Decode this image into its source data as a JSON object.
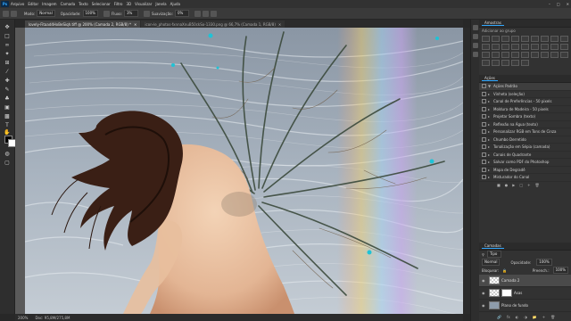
{
  "app": {
    "logo": "Ps",
    "menus": [
      "Arquivo",
      "Editar",
      "Imagem",
      "Camada",
      "Texto",
      "Selecionar",
      "Filtro",
      "3D",
      "Visualizar",
      "Janela",
      "Ajuda"
    ]
  },
  "options_bar": {
    "mode_label": "Modo:",
    "mode_value": "Normal",
    "opacity_label": "Opacidade:",
    "opacity_value": "100%",
    "flow_label": "Fluxo:",
    "flow_value": "3%",
    "smoothing_label": "Suavização:",
    "smoothing_value": "0%"
  },
  "doc_tabs": [
    {
      "label": "lovely-Fitaad4HxBeSiqh.tiff @ 200% (Camada 2, RGB/8) *",
      "active": true
    },
    {
      "label": "icon-le_photos-fxnnaXnuB50ckSo-1330.png @ 66,7% (Camada 1, RGB/8)",
      "active": false
    }
  ],
  "status": {
    "zoom": "200%",
    "doc": "Doc: 95,8M/275,8M"
  },
  "panels": {
    "swatches_title": "Amostras",
    "swatches_sub": "Adicionar ao grupo",
    "actions_title": "Ações",
    "actions": [
      "Ações Padrão",
      "Vinheta (seleção)",
      "Canal de Preferências - 50 pixels",
      "Moldura de Madeira - 50 pixels",
      "Projetar Sombra (texto)",
      "Reflexão na Água (texto)",
      "Personalizar RGB em Tons de Cinza",
      "Chumbo Derretido",
      "Tonalização em Sépia (camada)",
      "Canais de Quadrante",
      "Salvar como PDF do Photoshop",
      "Mapa de Degradê",
      "Misturador do Canal"
    ],
    "layers_title": "Camadas",
    "layer_filter": "Tipo",
    "blend_mode": "Normal",
    "opacity_label": "Opacidade:",
    "opacity_value": "100%",
    "lock_label": "Bloquear:",
    "fill_label": "Preench.:",
    "fill_value": "100%",
    "layers": [
      {
        "name": "Camada 2",
        "active": true
      },
      {
        "name": "Asas",
        "active": false
      },
      {
        "name": "Plano de fundo",
        "active": false
      }
    ]
  }
}
